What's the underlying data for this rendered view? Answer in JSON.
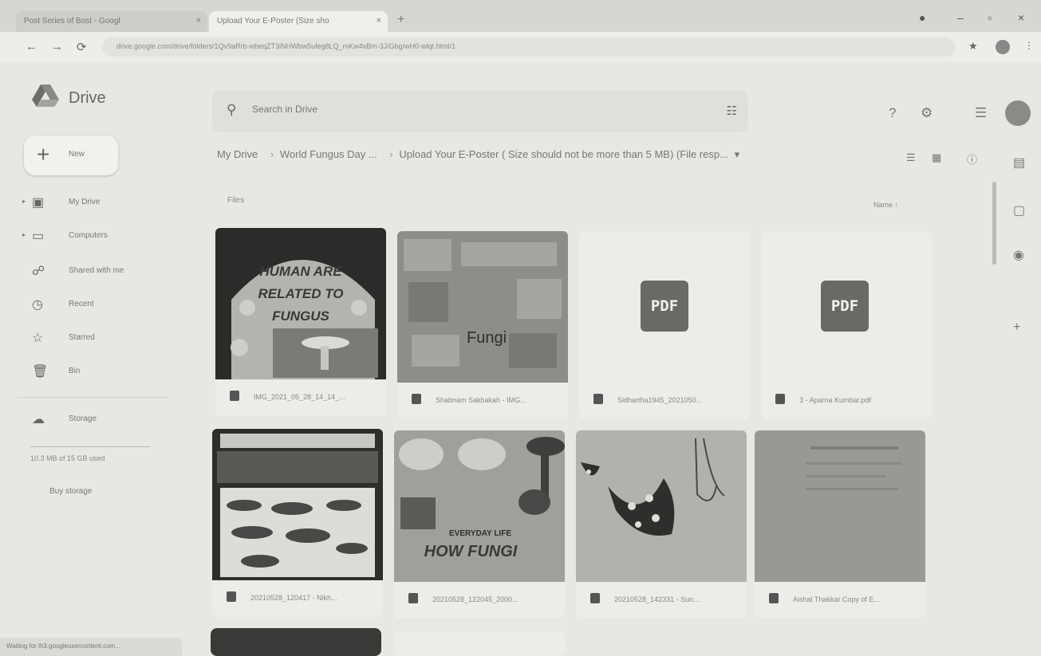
{
  "browser": {
    "tabs": [
      {
        "title": "Post Series of Bost - Googl",
        "close": "×"
      },
      {
        "title": "Upload Your E-Poster (Size sho",
        "close": "×"
      }
    ],
    "new_tab": "+",
    "url": "drive.google.com/drive/folders/1Qv9aRrb-wbeqZT3iNHWbw5ufeg8LQ_mKw4vBm-3J/Gbg/wH0-wlqt.html/1",
    "status_text": "Waiting for lh3.googleusercontent.com..."
  },
  "drive": {
    "logo_text": "Drive",
    "search_placeholder": "Search in Drive",
    "new_label": "New",
    "sidebar": [
      {
        "label": "My Drive",
        "icon": "drive-folder-icon",
        "glyph": "▣",
        "caret": "▸"
      },
      {
        "label": "Computers",
        "icon": "computer-icon",
        "glyph": "▭",
        "caret": "▸"
      },
      {
        "label": "Shared with me",
        "icon": "people-icon",
        "glyph": "☍",
        "caret": ""
      },
      {
        "label": "Recent",
        "icon": "clock-icon",
        "glyph": "◷",
        "caret": ""
      },
      {
        "label": "Starred",
        "icon": "star-icon",
        "glyph": "☆",
        "caret": ""
      },
      {
        "label": "Bin",
        "icon": "trash-icon",
        "glyph": "🗑",
        "caret": ""
      }
    ],
    "storage_label": "Storage",
    "storage_usage": "10.3 MB of 15 GB used",
    "buy_storage": "Buy storage",
    "breadcrumb": {
      "root": "My Drive",
      "mid": "World Fungus Day ...",
      "current": "Upload Your E-Poster ( Size should not be more than 5 MB) (File resp...",
      "sep": "›",
      "dropdown": "▾"
    },
    "files_label": "Files",
    "sort_label": "Name",
    "sort_arrow": "↑",
    "files": [
      {
        "name": "IMG_2021_05_28_14_14_...",
        "kind": "image",
        "thumb": "fungus-poster-1"
      },
      {
        "name": "Shabnam Sakbakah - IMG...",
        "kind": "image",
        "thumb": "fungi-collage"
      },
      {
        "name": "Sidhartha1945_2021050...",
        "kind": "pdf",
        "badge": "PDF"
      },
      {
        "name": "3 - Aparna Kumbar.pdf",
        "kind": "pdf",
        "badge": "PDF"
      },
      {
        "name": "20210528_120417 - Nikh...",
        "kind": "image",
        "thumb": "mushroom-chart"
      },
      {
        "name": "20210528_122045_2000...",
        "kind": "image",
        "thumb": "how-fungi-poster"
      },
      {
        "name": "20210528_142331 - Sun...",
        "kind": "image",
        "thumb": "spotted-fungi"
      },
      {
        "name": "Aishal Thakkar Copy of E...",
        "kind": "image",
        "thumb": "document-page"
      }
    ],
    "thumb_text": {
      "poster1_title": "HUMAN ARE RELATED TO FUNGUS",
      "poster2_title": "Fungi",
      "poster4_title": "HOW FUNGI",
      "poster4_sub": "EVERYDAY LIFE"
    }
  }
}
